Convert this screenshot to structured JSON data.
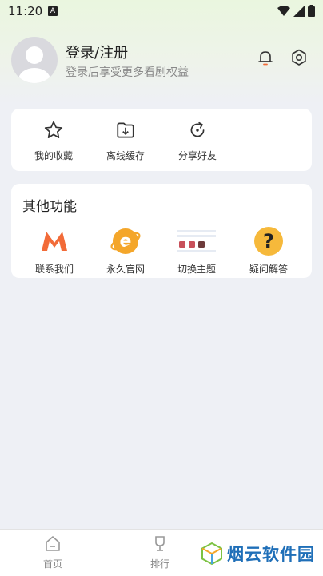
{
  "status_bar": {
    "time": "11:20",
    "notif_badge": "A"
  },
  "profile": {
    "title": "登录/注册",
    "subtitle": "登录后享受更多看剧权益"
  },
  "quick_actions": [
    {
      "label": "我的收藏",
      "icon": "star-icon"
    },
    {
      "label": "离线缓存",
      "icon": "download-folder-icon"
    },
    {
      "label": "分享好友",
      "icon": "share-refresh-icon"
    }
  ],
  "other": {
    "title": "其他功能",
    "items": [
      {
        "label": "联系我们",
        "icon": "m-logo-icon"
      },
      {
        "label": "永久官网",
        "icon": "browser-e-icon"
      },
      {
        "label": "切换主题",
        "icon": "theme-palette-icon"
      },
      {
        "label": "疑问解答",
        "icon": "question-icon"
      }
    ]
  },
  "bottom_nav": [
    {
      "label": "首页",
      "icon": "home-icon"
    },
    {
      "label": "排行",
      "icon": "ranking-icon"
    }
  ],
  "watermark": {
    "text": "烟云软件园"
  },
  "colors": {
    "accent_orange": "#f26b38",
    "icon_orange": "#f4a62a",
    "question_yellow": "#f6b93b",
    "watermark_blue": "#1f6fb8"
  }
}
